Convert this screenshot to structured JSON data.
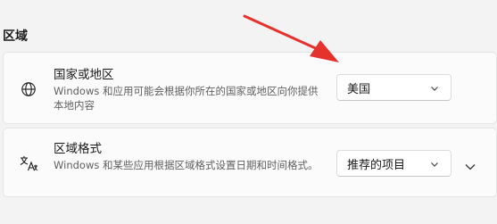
{
  "section": {
    "title": "区域"
  },
  "country": {
    "title": "国家或地区",
    "description": "Windows 和应用可能会根据你所在的国家或地区向你提供本地内容",
    "icon": "globe-icon",
    "selected": "美国"
  },
  "format": {
    "title": "区域格式",
    "description": "Windows 和某些应用根据区域格式设置日期和时间格式。",
    "icon": "language-format-icon",
    "selected": "推荐的项目",
    "expand_icon": "chevron-down-icon"
  },
  "annotation": {
    "icon": "red-arrow-icon",
    "color": "#e5322d"
  }
}
